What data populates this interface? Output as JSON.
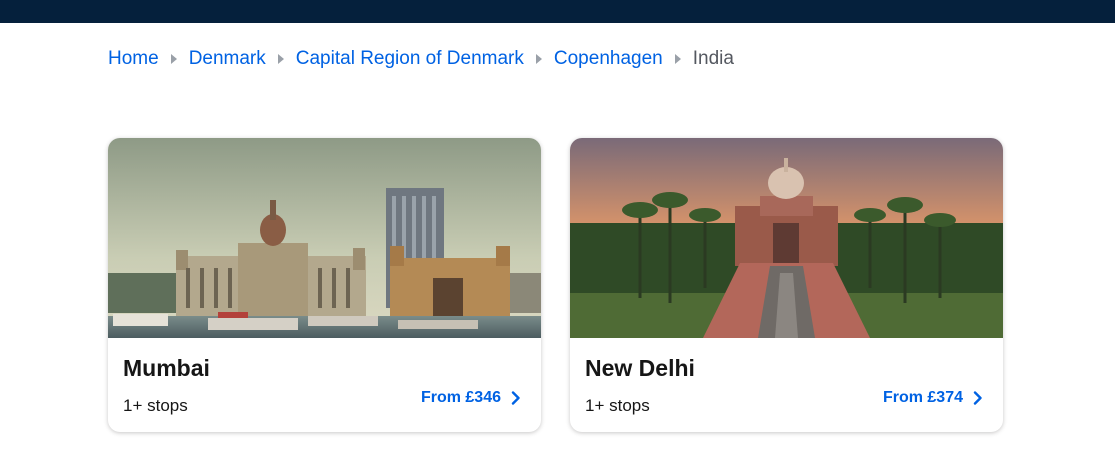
{
  "breadcrumb": {
    "items": [
      "Home",
      "Denmark",
      "Capital Region of Denmark",
      "Copenhagen"
    ],
    "current": "India"
  },
  "cards": [
    {
      "city": "Mumbai",
      "stops": "1+ stops",
      "price": "From £346"
    },
    {
      "city": "New Delhi",
      "stops": "1+ stops",
      "price": "From £374"
    }
  ],
  "colors": {
    "topbar": "#05203c",
    "link": "#0062e3",
    "text": "#161616"
  }
}
